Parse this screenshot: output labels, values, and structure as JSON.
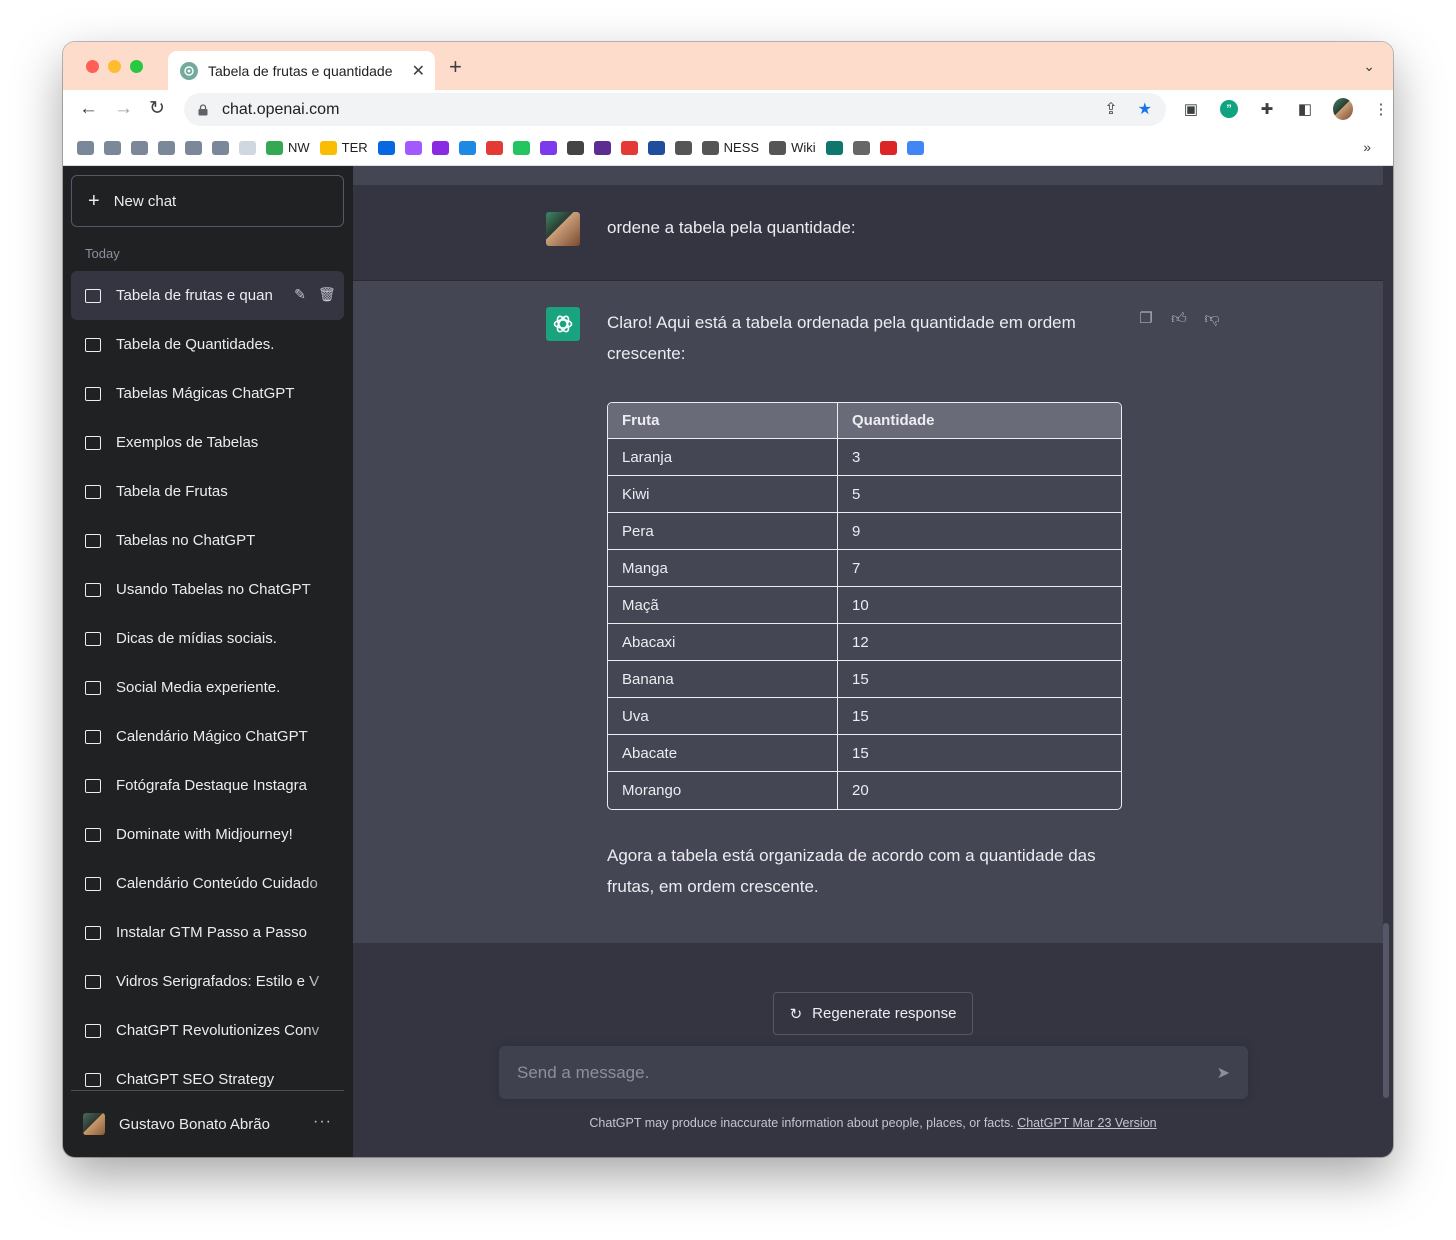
{
  "browser": {
    "tab_title": "Tabela de frutas e quantidade",
    "url": "chat.openai.com",
    "bookmarks": [
      {
        "label": "",
        "color": "#7a8899"
      },
      {
        "label": "",
        "color": "#7a8899"
      },
      {
        "label": "",
        "color": "#7a8899"
      },
      {
        "label": "",
        "color": "#7a8899"
      },
      {
        "label": "",
        "color": "#7a8899"
      },
      {
        "label": "",
        "color": "#7a8899"
      },
      {
        "label": "",
        "color": "#d0d7e0"
      },
      {
        "label": "NW",
        "color": "#34a853"
      },
      {
        "label": "TER",
        "color": "#fbbc04"
      },
      {
        "label": "",
        "color": "#0668e1"
      },
      {
        "label": "",
        "color": "#a259ff"
      },
      {
        "label": "",
        "color": "#8a2be2"
      },
      {
        "label": "",
        "color": "#1e88e5"
      },
      {
        "label": "",
        "color": "#e53935"
      },
      {
        "label": "",
        "color": "#22c55e"
      },
      {
        "label": "",
        "color": "#7c3aed"
      },
      {
        "label": "",
        "color": "#444444"
      },
      {
        "label": "",
        "color": "#5b2d90"
      },
      {
        "label": "",
        "color": "#e53935"
      },
      {
        "label": "",
        "color": "#1f4e9e"
      },
      {
        "label": "",
        "color": "#555555"
      },
      {
        "label": "NESS",
        "color": "#555555"
      },
      {
        "label": "Wiki",
        "color": "#555555"
      },
      {
        "label": "",
        "color": "#0f766e"
      },
      {
        "label": "",
        "color": "#666666"
      },
      {
        "label": "",
        "color": "#dc2626"
      },
      {
        "label": "",
        "color": "#4285f4"
      }
    ],
    "bookmarks_more": "»"
  },
  "sidebar": {
    "new_chat_label": "New chat",
    "section_label": "Today",
    "chats": [
      "Tabela de frutas e quan",
      "Tabela de Quantidades.",
      "Tabelas Mágicas ChatGPT",
      "Exemplos de Tabelas",
      "Tabela de Frutas",
      "Tabelas no ChatGPT",
      "Usando Tabelas no ChatGPT",
      "Dicas de mídias sociais.",
      "Social Media experiente.",
      "Calendário Mágico ChatGPT",
      "Fotógrafa Destaque Instagra",
      "Dominate with Midjourney!",
      "Calendário Conteúdo Cuidado",
      "Instalar GTM Passo a Passo",
      "Vidros Serigrafados: Estilo e V",
      "ChatGPT Revolutionizes Conv",
      "ChatGPT SEO Strategy"
    ],
    "user_name": "Gustavo Bonato Abrão"
  },
  "conversation": {
    "user_message": "ordene a tabela pela quantidade:",
    "assistant_intro": "Claro! Aqui está a tabela ordenada pela quantidade em ordem crescente:",
    "table": {
      "headers": [
        "Fruta",
        "Quantidade"
      ],
      "rows": [
        [
          "Laranja",
          "3"
        ],
        [
          "Kiwi",
          "5"
        ],
        [
          "Pera",
          "9"
        ],
        [
          "Manga",
          "7"
        ],
        [
          "Maçã",
          "10"
        ],
        [
          "Abacaxi",
          "12"
        ],
        [
          "Banana",
          "15"
        ],
        [
          "Uva",
          "15"
        ],
        [
          "Abacate",
          "15"
        ],
        [
          "Morango",
          "20"
        ]
      ]
    },
    "assistant_outro": "Agora a tabela está organizada de acordo com a quantidade das frutas, em ordem crescente."
  },
  "composer": {
    "regenerate_label": "Regenerate response",
    "placeholder": "Send a message.",
    "disclaimer": "ChatGPT may produce inaccurate information about people, places, or facts.",
    "version_link": "ChatGPT Mar 23 Version"
  },
  "colors": {
    "sidebar_bg": "#202123",
    "main_bg": "#343541",
    "assistant_bg": "#444654",
    "brand_green": "#19a37f"
  }
}
